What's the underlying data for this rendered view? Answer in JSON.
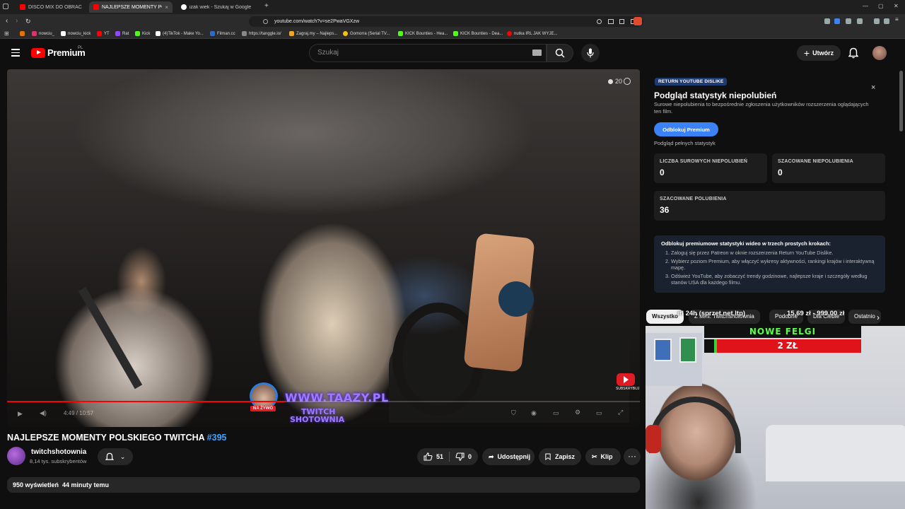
{
  "browser": {
    "tabs": [
      {
        "label": "DISCO MIX DO OBRACANIA PO",
        "active": false,
        "color": "#ff0000"
      },
      {
        "label": "NAJLEPSZE MOMENTY POLSKI",
        "active": true,
        "color": "#ff0000"
      },
      {
        "label": "izak wiek - Szukaj w Google",
        "active": false,
        "color": "#4285f4"
      }
    ],
    "url": "youtube.com/watch?v=se2PwaVGXzw",
    "bookmarks": [
      {
        "label": "",
        "color": "#e37400"
      },
      {
        "label": "nowciu_",
        "color": "#e1306c"
      },
      {
        "label": "nowciu_kick",
        "color": "#ffffff"
      },
      {
        "label": "YT",
        "color": "#ff0000"
      },
      {
        "label": "Rat",
        "color": "#9146ff"
      },
      {
        "label": "Kick",
        "color": "#53fc18"
      },
      {
        "label": "(4)TikTok - Make Yo...",
        "color": "#ffffff"
      },
      {
        "label": "Filman.cc",
        "color": "#2b6bd1"
      },
      {
        "label": "https://tanggle.io/",
        "color": "#888888"
      },
      {
        "label": "Zagraj.my – Najleps...",
        "color": "#f5a623"
      },
      {
        "label": "Gomorra (Serial TV...",
        "color": "#f4c20d"
      },
      {
        "label": "KICK Bounties - Hea...",
        "color": "#53fc18"
      },
      {
        "label": "KICK Bounties - Dea...",
        "color": "#53fc18"
      },
      {
        "label": "nutka IRL JAK WYJE...",
        "color": "#ff0000"
      }
    ]
  },
  "header": {
    "brand": "Premium",
    "country": "PL",
    "search_placeholder": "Szukaj",
    "create_label": "Utwórz"
  },
  "player": {
    "timer_text": "20",
    "overlay_site": "WWW.TAAZY.PL",
    "overlay_twitch": "TWITCH",
    "overlay_shotownia": "SHOTOWNIA",
    "live_badge": "NA ŻYWO",
    "watermark_label": "SUBSKRYBUJ",
    "time_text": "4:49 / 10:57",
    "progress_fraction": 0.44
  },
  "video": {
    "title": "NAJLEPSZE MOMENTY POLSKIEGO TWITCHA",
    "title_tag": "#395",
    "channel_name": "twitchshotownia",
    "channel_subs": "8,14 tys. subskrybentów",
    "likes": "51",
    "dislikes": "0",
    "share_label": "Udostępnij",
    "save_label": "Zapisz",
    "clip_label": "Klip",
    "views_line": "950 wyświetleń  44 minuty temu"
  },
  "rytd": {
    "badge": "RETURN YOUTUBE DISLIKE",
    "title": "Podgląd statystyk niepolubień",
    "description": "Surowe niepolubienia to bezpośrednie zgłoszenia użytkowników rozszerzenia oglądających ten film.",
    "unlock_label": "Odblokuj Premium",
    "full_stats_label": "Podgląd pełnych statystyk",
    "cards": [
      {
        "label": "LICZBA SUROWYCH NIEPOLUBIEŃ",
        "value": "0"
      },
      {
        "label": "SZACOWANE NIEPOLUBIENIA",
        "value": "0"
      },
      {
        "label": "SZACOWANE POLUBIENIA",
        "value": "36"
      }
    ],
    "premium_heading": "Odblokuj premiumowe statystyki wideo w trzech prostych krokach:",
    "premium_steps": [
      "Zaloguj się przez Patreon w oknie rozszerzenia Return YouTube Dislike.",
      "Wybierz poziom Premium, aby włączyć wykresy aktywności, rankingi krajów i interaktywną mapę.",
      "Odśwież YouTube, aby zobaczyć trendy godzinowe, najlepsze kraje i szczegóły według stanów USA dla każdego filmu."
    ]
  },
  "chips": {
    "items": [
      "Wszystko",
      "Z serii: Twitchshotownia",
      "Podobne",
      "Dla Ciebie",
      "Ostatnio"
    ]
  },
  "stream_overlay": {
    "goal_label": "irl 24h (sprzet,net,ltp)",
    "goal_amounts": "15,69 zł - 999,00 zł",
    "felgi_title": "NOWE FELGI",
    "felgi_amount": "2 ZŁ",
    "felgi_fraction": 0.02
  },
  "colors": {
    "accent_red": "#ff0000",
    "link_blue": "#3ea6ff",
    "unlock_blue": "#3b82f6"
  }
}
